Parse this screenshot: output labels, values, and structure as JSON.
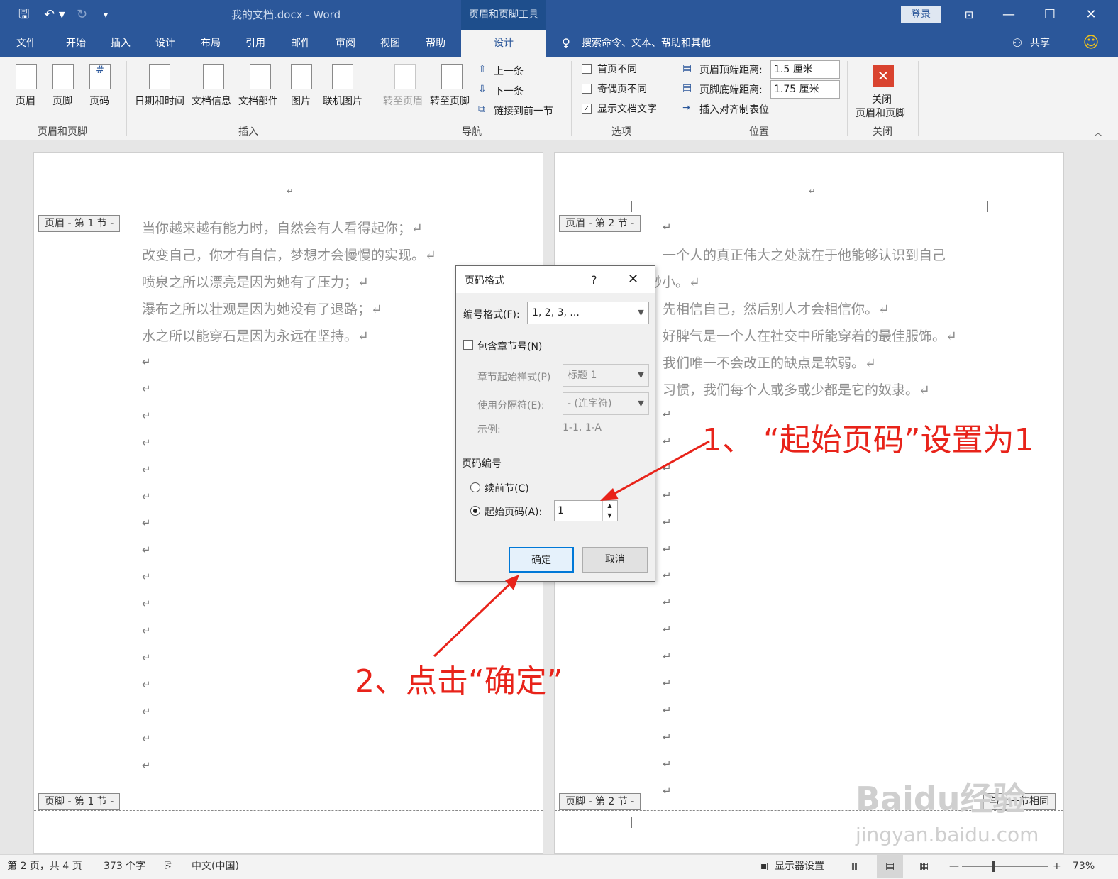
{
  "titlebar": {
    "doc_title": "我的文档.docx - Word",
    "context_tab": "页眉和页脚工具",
    "login": "登录",
    "undo_icon": "undo-icon",
    "minimize": "—",
    "maximize": "☐",
    "close": "✕"
  },
  "tabs": [
    "文件",
    "开始",
    "插入",
    "设计",
    "布局",
    "引用",
    "邮件",
    "审阅",
    "视图",
    "帮助",
    "设计"
  ],
  "tell_me": "搜索命令、文本、帮助和其他",
  "share": "共享",
  "ribbon": {
    "group_hf": {
      "label": "页眉和页脚",
      "header": "页眉",
      "footer": "页脚",
      "pagenum": "页码"
    },
    "group_insert": {
      "label": "插入",
      "datetime": "日期和时间",
      "docinfo": "文档信息",
      "parts": "文档部件",
      "picture": "图片",
      "online": "联机图片"
    },
    "group_nav": {
      "label": "导航",
      "goto_header": "转至页眉",
      "goto_footer": "转至页脚",
      "prev": "上一条",
      "next": "下一条",
      "link": "链接到前一节"
    },
    "group_options": {
      "label": "选项",
      "first": "首页不同",
      "oddeven": "奇偶页不同",
      "showtext": "显示文档文字"
    },
    "group_position": {
      "label": "位置",
      "top_label": "页眉顶端距离:",
      "top_value": "1.5 厘米",
      "bottom_label": "页脚底端距离:",
      "bottom_value": "1.75 厘米",
      "align": "插入对齐制表位"
    },
    "group_close": {
      "label": "关闭",
      "close_line1": "关闭",
      "close_line2": "页眉和页脚"
    }
  },
  "page1": {
    "header_tag": "页眉 - 第 1 节 -",
    "footer_tag": "页脚 - 第 1 节 -",
    "lines": [
      "当你越来越有能力时，自然会有人看得起你；↵",
      "改变自己，你才有自信，梦想才会慢慢的实现。↵",
      "喷泉之所以漂亮是因为她有了压力；↵",
      "瀑布之所以壮观是因为她没有了退路；↵",
      "水之所以能穿石是因为永远在坚持。↵"
    ],
    "return_mark": "↵"
  },
  "page2": {
    "header_tag": "页眉 - 第 2 节 -",
    "footer_tag": "页脚 - 第 2 节 -",
    "lines": [
      "一个人的真正伟大之处就在于他能够认识到自己",
      "渺小。↵",
      "先相信自己，然后别人才会相信你。↵",
      "好脾气是一个人在社交中所能穿着的最佳服饰。↵",
      "我们唯一不会改正的缺点是软弱。↵",
      "习惯，我们每个人或多或少都是它的奴隶。↵"
    ],
    "footer_right": "与上一节相同"
  },
  "dialog": {
    "title": "页码格式",
    "help": "?",
    "close": "✕",
    "format_label": "编号格式(F):",
    "format_value": "1, 2, 3, ...",
    "include_chapter": "包含章节号(N)",
    "chapter_style_label": "章节起始样式(P)",
    "chapter_style_value": "标题 1",
    "separator_label": "使用分隔符(E):",
    "separator_value": "- (连字符)",
    "example_label": "示例:",
    "example_value": "1-1, 1-A",
    "numbering_title": "页码编号",
    "continue": "续前节(C)",
    "start_at": "起始页码(A):",
    "start_value": "1",
    "ok": "确定",
    "cancel": "取消"
  },
  "annotations": {
    "step1": "1、 “起始页码”设置为1",
    "step2": "2、点击“确定”"
  },
  "watermark": {
    "brand": "Baidu经验",
    "url": "jingyan.baidu.com"
  },
  "status": {
    "page": "第 2 页，共 4 页",
    "words": "373 个字",
    "lang": "中文(中国)",
    "display": "显示器设置",
    "zoom": "73%"
  },
  "colors": {
    "word_blue": "#2b579a",
    "annotation_red": "#e8231a"
  }
}
